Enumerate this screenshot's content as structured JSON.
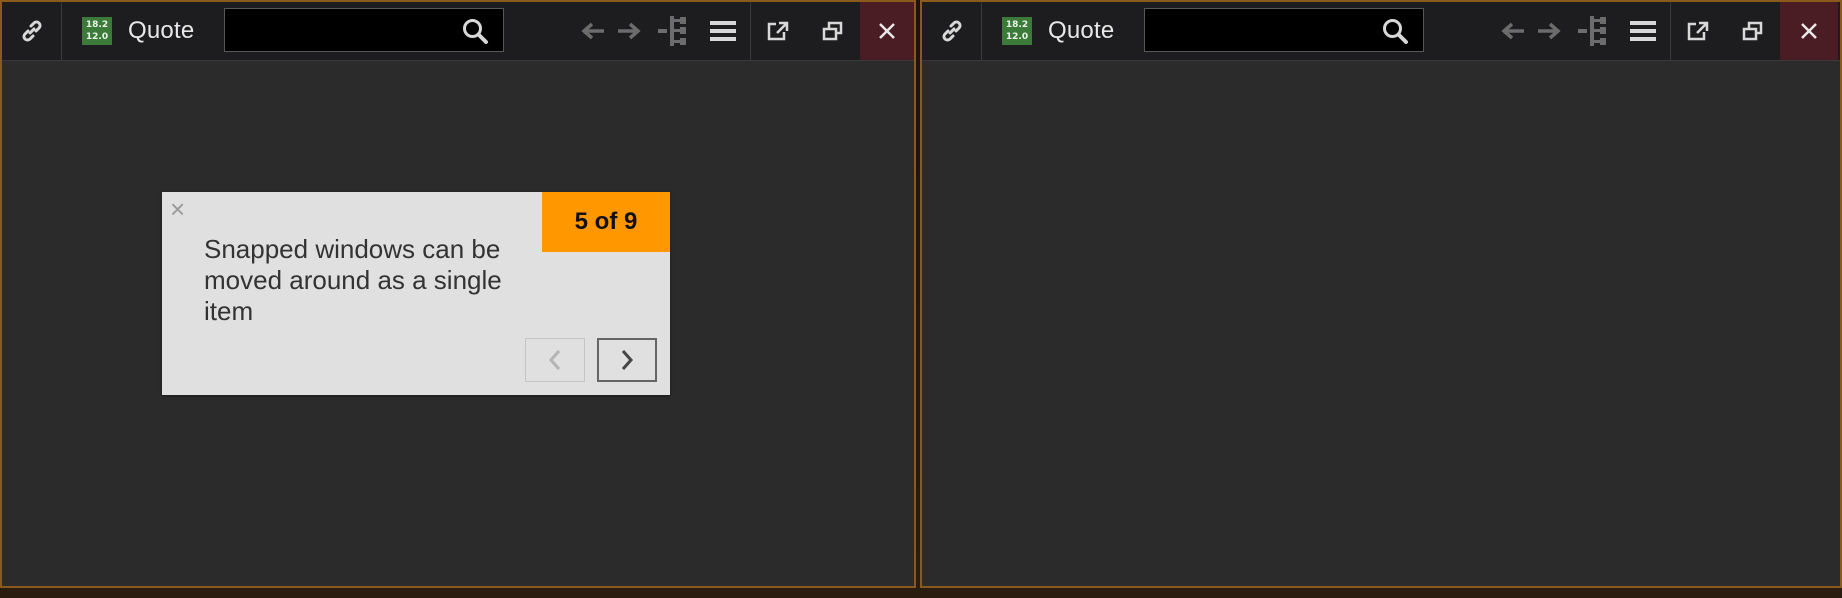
{
  "windows": [
    {
      "badge": {
        "top": "18.2",
        "bottom": "12.0"
      },
      "title": "Quote",
      "search": {
        "value": "",
        "placeholder": ""
      },
      "icons": [
        "link-icon",
        "search-icon",
        "back-arrow-icon",
        "forward-arrow-icon",
        "hierarchy-icon",
        "menu-icon",
        "popout-icon",
        "restore-icon",
        "close-icon"
      ]
    },
    {
      "badge": {
        "top": "18.2",
        "bottom": "12.0"
      },
      "title": "Quote",
      "search": {
        "value": "",
        "placeholder": ""
      },
      "icons": [
        "link-icon",
        "search-icon",
        "back-arrow-icon",
        "forward-arrow-icon",
        "hierarchy-icon",
        "menu-icon",
        "popout-icon",
        "restore-icon",
        "close-icon"
      ]
    }
  ],
  "tour": {
    "counter": "5 of 9",
    "message": "Snapped windows can be moved around as a single item",
    "close_glyph": "×",
    "prev_icon": "chevron-left-icon",
    "next_icon": "chevron-right-icon"
  },
  "colors": {
    "titlebar": "#1d1d1f",
    "content": "#2b2b2b",
    "window_border": "#8a5a1c",
    "badge": "#3c7a3a",
    "close_bg": "#4a1c23",
    "tour_bg": "#e0e0e0",
    "tour_accent": "#ff9800"
  }
}
